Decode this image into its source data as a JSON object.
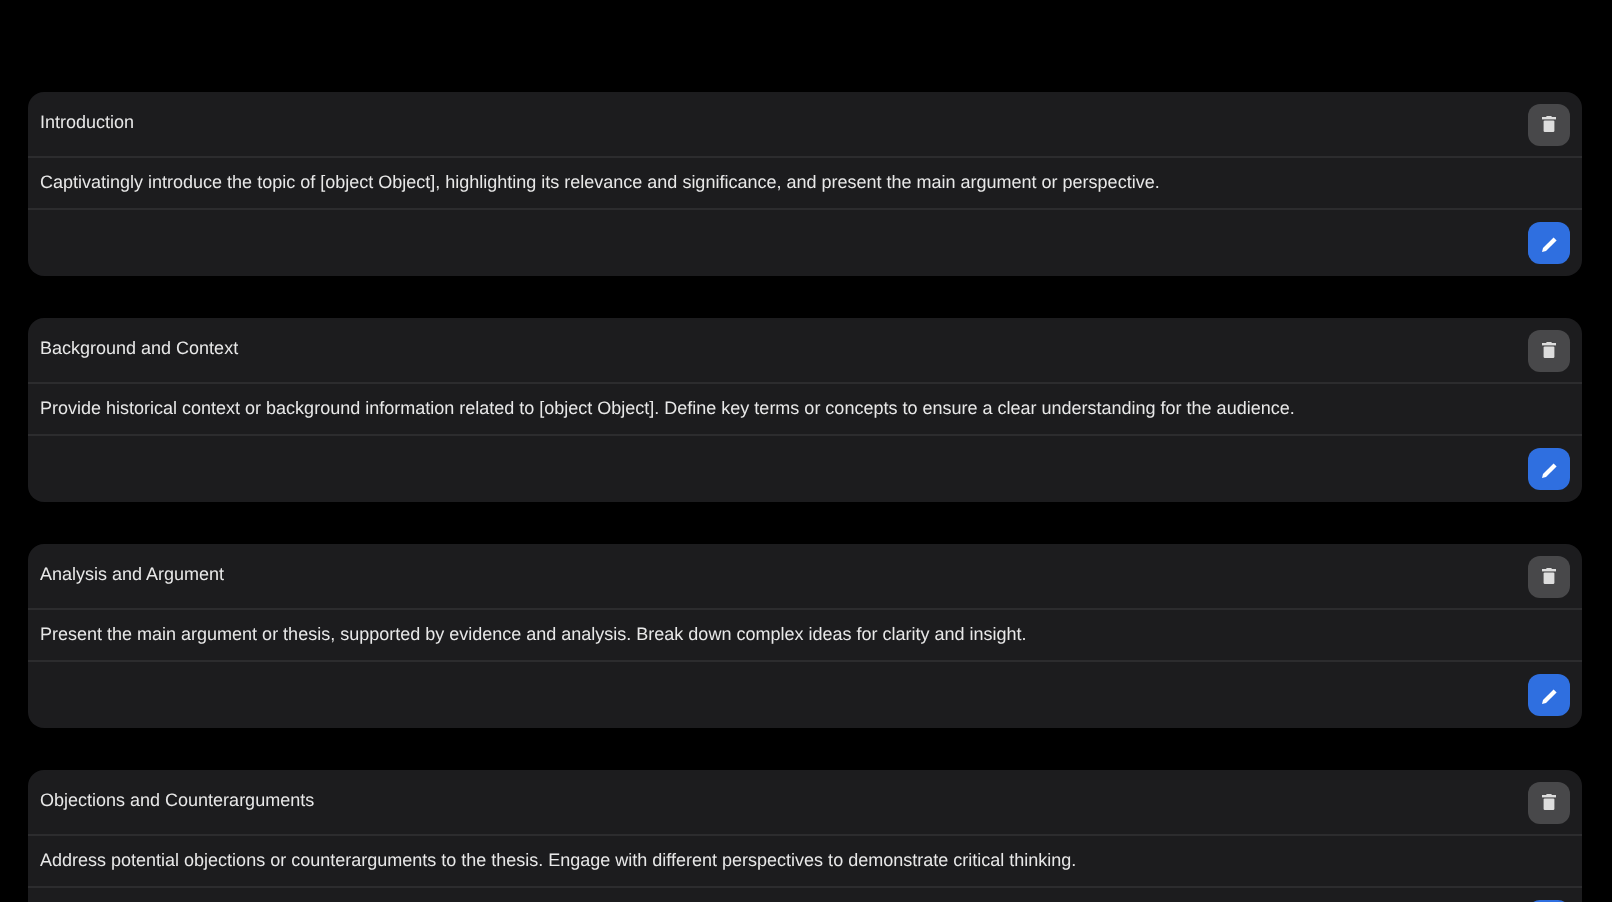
{
  "sections": [
    {
      "title": "Introduction",
      "description": "Captivatingly introduce the topic of [object Object], highlighting its relevance and significance, and present the main argument or perspective."
    },
    {
      "title": "Background and Context",
      "description": "Provide historical context or background information related to [object Object]. Define key terms or concepts to ensure a clear understanding for the audience."
    },
    {
      "title": "Analysis and Argument",
      "description": "Present the main argument or thesis, supported by evidence and analysis. Break down complex ideas for clarity and insight."
    },
    {
      "title": "Objections and Counterarguments",
      "description": "Address potential objections or counterarguments to the thesis. Engage with different perspectives to demonstrate critical thinking."
    }
  ]
}
